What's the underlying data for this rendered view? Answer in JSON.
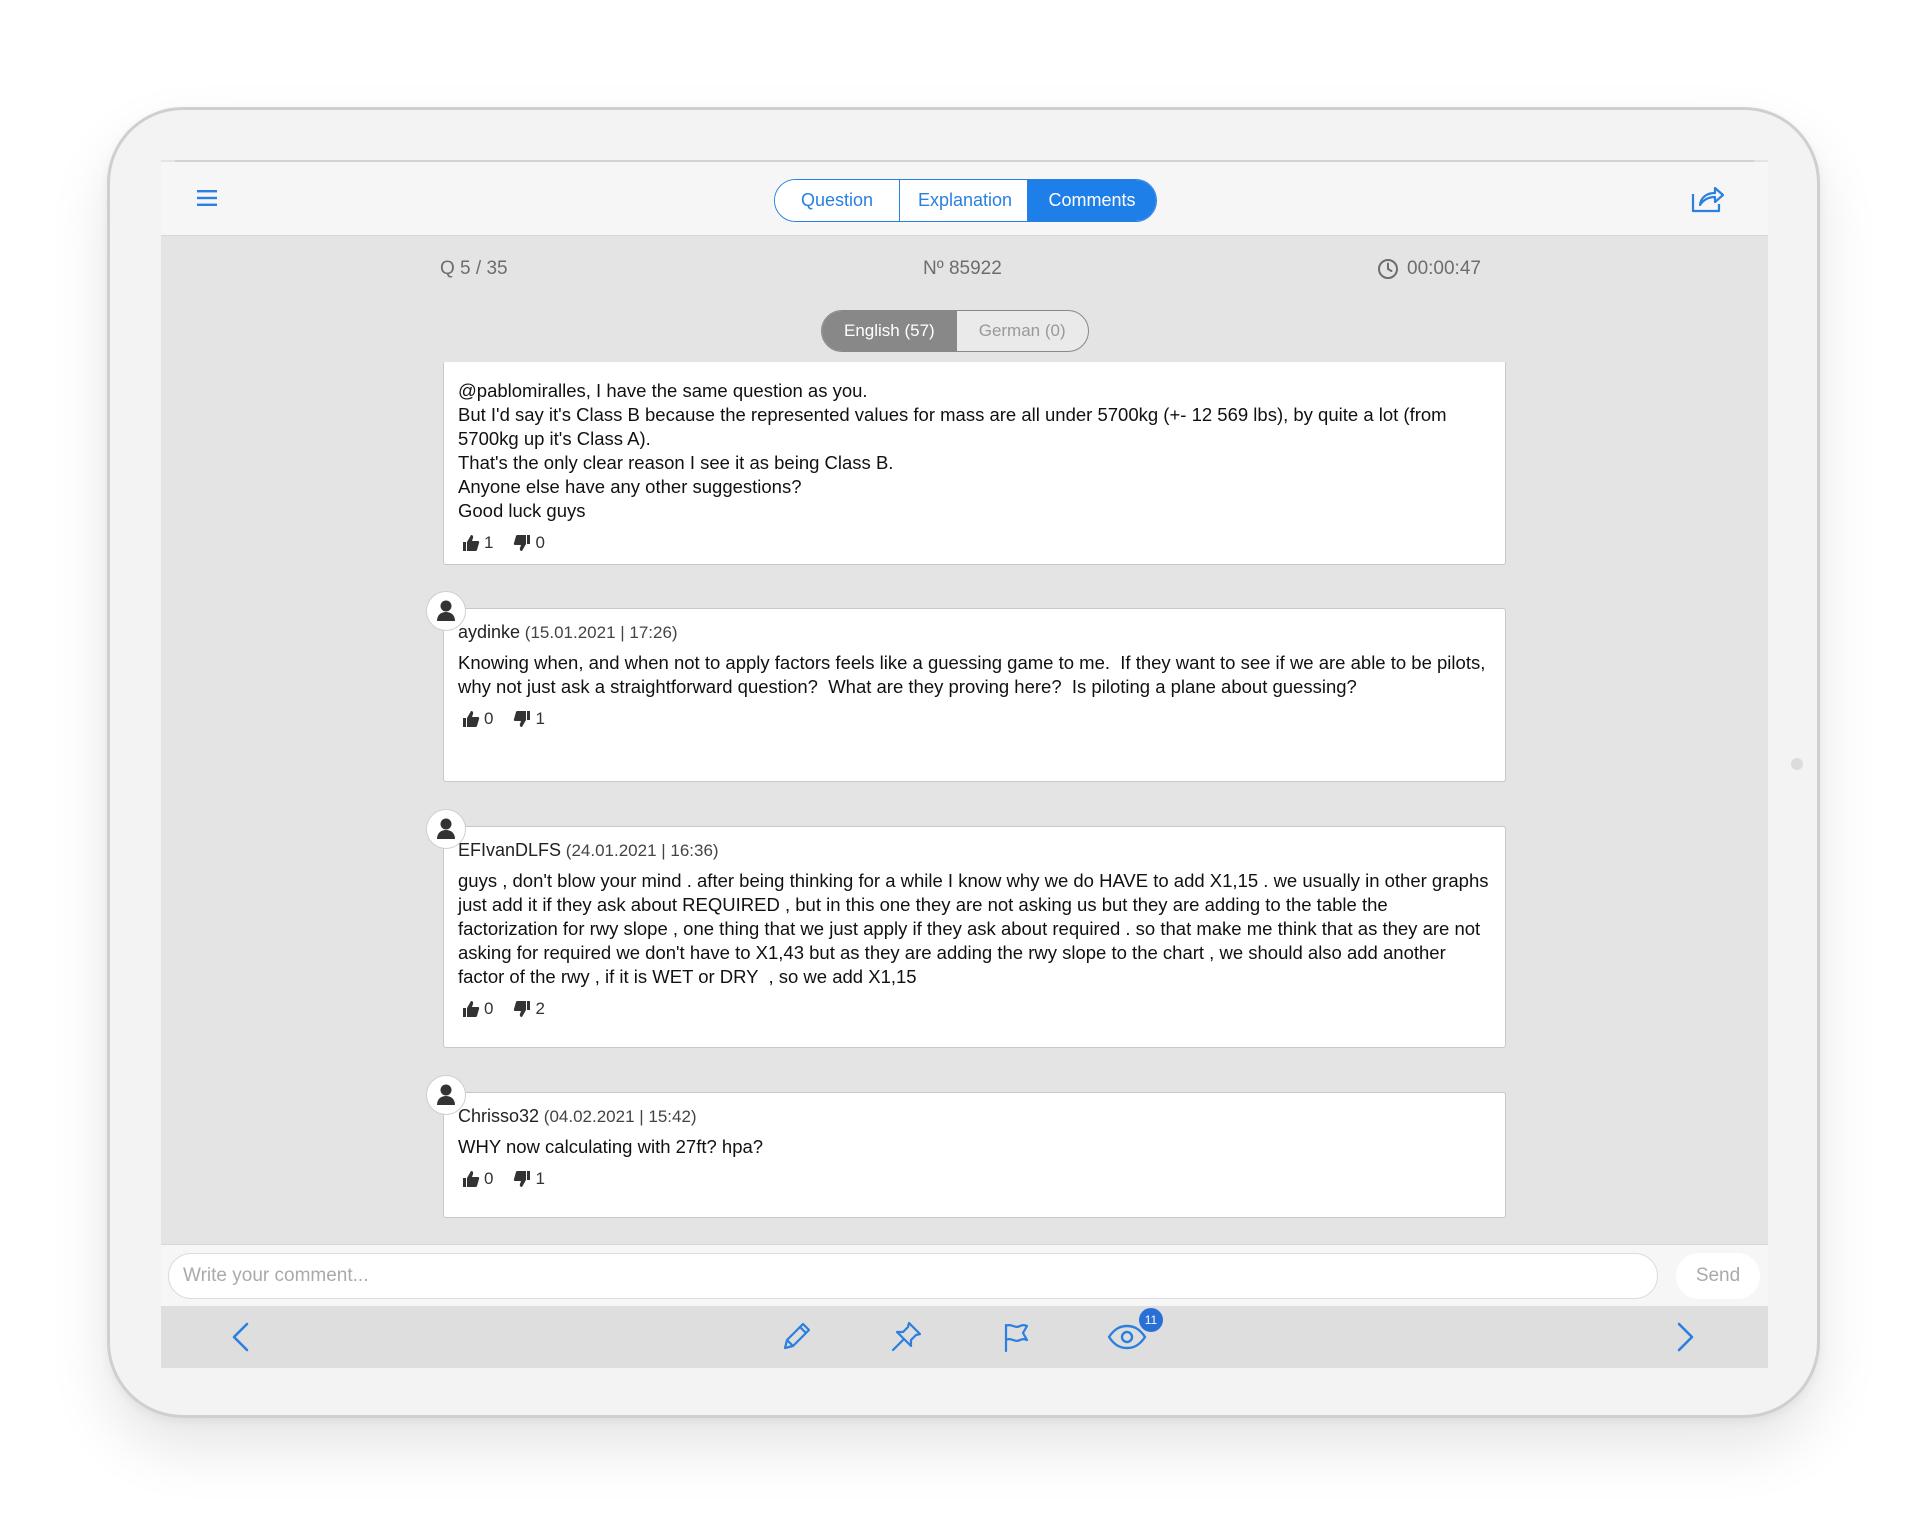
{
  "nav": {
    "tabs": [
      {
        "label": "Question",
        "active": false
      },
      {
        "label": "Explanation",
        "active": false
      },
      {
        "label": "Comments",
        "active": true
      }
    ]
  },
  "info": {
    "question_counter": "Q  5 / 35",
    "question_number": "Nº 85922",
    "timer": "00:00:47"
  },
  "language_tabs": [
    {
      "label": "English (57)",
      "active": true
    },
    {
      "label": "German (0)",
      "active": false
    }
  ],
  "comments": [
    {
      "user": "",
      "date": "",
      "body": "@pablomiralles, I have the same question as you.\nBut I'd say it's Class B because the represented values for mass are all under 5700kg (+- 12 569 lbs), by quite a lot (from 5700kg up it's Class A).\nThat's the only clear reason I see it as being Class B.\nAnyone else have any other suggestions?\nGood luck guys",
      "likes": "1",
      "dislikes": "0"
    },
    {
      "user": "aydinke",
      "date": "(15.01.2021 | 17:26)",
      "body": "Knowing when, and when not to apply factors feels like a guessing game to me.  If they want to see if we are able to be pilots, why not just ask a straightforward question?  What are they proving here?  Is piloting a plane about guessing?",
      "likes": "0",
      "dislikes": "1"
    },
    {
      "user": "EFIvanDLFS",
      "date": "(24.01.2021 | 16:36)",
      "body": "guys , don't blow your mind . after being thinking for a while I know why we do HAVE to add X1,15 . we usually in other graphs just add it if they ask about REQUIRED , but in this one they are not asking us but they are adding to the table the factorization for rwy slope , one thing that we just apply if they ask about required . so that make me think that as they are not asking for required we don't have to X1,43 but as they are adding the rwy slope to the chart , we should also add another factor of the rwy , if it is WET or DRY  , so we add X1,15",
      "likes": "0",
      "dislikes": "2"
    },
    {
      "user": "Chrisso32",
      "date": "(04.02.2021 | 15:42)",
      "body": "WHY now calculating with 27ft? hpa?",
      "likes": "0",
      "dislikes": "1"
    }
  ],
  "composer": {
    "placeholder": "Write your comment...",
    "send_label": "Send"
  },
  "toolbar": {
    "views_badge": "11"
  },
  "colors": {
    "accent": "#1f7fe8",
    "badge": "#2a6fd6"
  }
}
